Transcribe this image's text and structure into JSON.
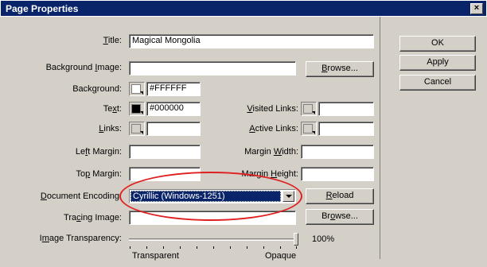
{
  "window": {
    "title": "Page Properties",
    "close_glyph": "×"
  },
  "fields": {
    "title": {
      "pre": "",
      "acc": "T",
      "post": "itle:",
      "value": "Magical Mongolia"
    },
    "background_image": {
      "pre": "Background ",
      "acc": "I",
      "post": "mage:",
      "value": ""
    },
    "background": {
      "pre": "Back",
      "acc": "g",
      "post": "round:",
      "value": "#FFFFFF",
      "color": "#FFFFFF"
    },
    "text": {
      "pre": "Te",
      "acc": "x",
      "post": "t:",
      "value": "#000000",
      "color": "#000000"
    },
    "links": {
      "pre": "",
      "acc": "L",
      "post": "inks:",
      "value": ""
    },
    "visited_links": {
      "pre": "",
      "acc": "V",
      "post": "isited Links:",
      "value": ""
    },
    "active_links": {
      "pre": "",
      "acc": "A",
      "post": "ctive Links:",
      "value": ""
    },
    "left_margin": {
      "pre": "Le",
      "acc": "f",
      "post": "t Margin:",
      "value": ""
    },
    "margin_width": {
      "pre": "Margin ",
      "acc": "W",
      "post": "idth:",
      "value": ""
    },
    "top_margin": {
      "pre": "To",
      "acc": "p",
      "post": " Margin:",
      "value": ""
    },
    "margin_height": {
      "pre": "Margin ",
      "acc": "H",
      "post": "eight:",
      "value": ""
    },
    "document_encoding": {
      "pre": "",
      "acc": "D",
      "post": "ocument Encoding:",
      "value": "Cyrillic (Windows-1251)"
    },
    "tracing_image": {
      "pre": "Tra",
      "acc": "c",
      "post": "ing Image:",
      "value": ""
    },
    "image_transparency": {
      "pre": "I",
      "acc": "m",
      "post": "age Transparency:",
      "value": "100%",
      "level": 1.0,
      "min_label": "Transparent",
      "max_label": "Opaque"
    }
  },
  "buttons": {
    "browse1": {
      "pre": "",
      "acc": "B",
      "post": "rowse..."
    },
    "reload": {
      "pre": "",
      "acc": "R",
      "post": "eload"
    },
    "browse2": {
      "pre": "Br",
      "acc": "o",
      "post": "wse..."
    },
    "ok": "OK",
    "apply": "Apply",
    "cancel": "Cancel"
  },
  "colors": {
    "titlebar": "#0a246a",
    "dialog": "#d4d0c8",
    "highlight": "#0a246a",
    "annotation": "#e02020"
  }
}
